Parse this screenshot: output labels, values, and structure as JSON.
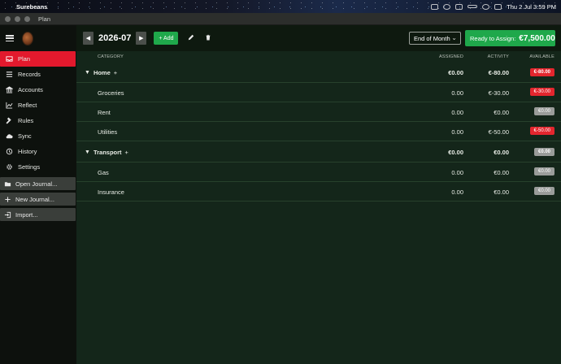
{
  "menubar": {
    "app_name": "Surebeans",
    "datetime": "Thu 2 Jul  3:59 PM"
  },
  "window": {
    "title": "Plan"
  },
  "sidebar": {
    "items": [
      {
        "label": "Plan",
        "icon": "inbox-icon",
        "active": true
      },
      {
        "label": "Records",
        "icon": "list-icon",
        "active": false
      },
      {
        "label": "Accounts",
        "icon": "bank-icon",
        "active": false
      },
      {
        "label": "Reflect",
        "icon": "chart-icon",
        "active": false
      },
      {
        "label": "Rules",
        "icon": "gavel-icon",
        "active": false
      },
      {
        "label": "Sync",
        "icon": "cloud-sync-icon",
        "active": false
      },
      {
        "label": "History",
        "icon": "history-icon",
        "active": false
      },
      {
        "label": "Settings",
        "icon": "gear-icon",
        "active": false
      }
    ],
    "buttons": [
      {
        "label": "Open Journal...",
        "icon": "folder-icon"
      },
      {
        "label": "New Journal...",
        "icon": "plus-icon"
      },
      {
        "label": "Import...",
        "icon": "import-icon"
      }
    ]
  },
  "toolbar": {
    "period": "2026-07",
    "add_label": "+ Add",
    "range_select": "End of Month",
    "ready_label": "Ready to Assign:",
    "ready_amount": "€7,500.00"
  },
  "table": {
    "headers": {
      "category": "CATEGORY",
      "assigned": "ASSIGNED",
      "activity": "ACTIVITY",
      "available": "AVAILABLE"
    },
    "rows": [
      {
        "type": "group",
        "name": "Home",
        "assigned": "€0.00",
        "activity": "€-80.00",
        "available": "€-80.00",
        "status": "neg"
      },
      {
        "type": "item",
        "name": "Groceries",
        "assigned": "0.00",
        "activity": "€-30.00",
        "available": "€-30.00",
        "status": "neg"
      },
      {
        "type": "item",
        "name": "Rent",
        "assigned": "0.00",
        "activity": "€0.00",
        "available": "€0.00",
        "status": "zero"
      },
      {
        "type": "item",
        "name": "Utilities",
        "assigned": "0.00",
        "activity": "€-50.00",
        "available": "€-50.00",
        "status": "neg"
      },
      {
        "type": "group",
        "name": "Transport",
        "assigned": "€0.00",
        "activity": "€0.00",
        "available": "€0.00",
        "status": "zero"
      },
      {
        "type": "item",
        "name": "Gas",
        "assigned": "0.00",
        "activity": "€0.00",
        "available": "€0.00",
        "status": "zero"
      },
      {
        "type": "item",
        "name": "Insurance",
        "assigned": "0.00",
        "activity": "€0.00",
        "available": "€0.00",
        "status": "zero"
      }
    ]
  },
  "colors": {
    "accent_red": "#e3192d",
    "accent_green": "#1fa84b",
    "main_bg": "#14261a",
    "sidebar_bg": "#0d110d"
  }
}
